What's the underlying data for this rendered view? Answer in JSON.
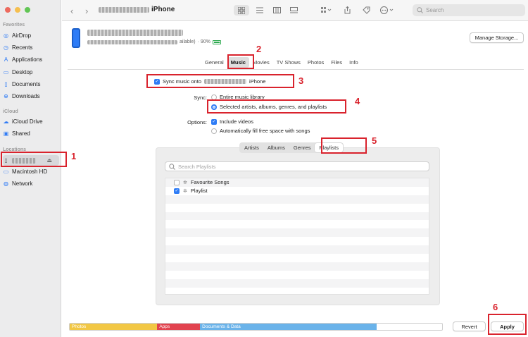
{
  "sidebar": {
    "favorites_header": "Favorites",
    "favorites": [
      {
        "label": "AirDrop",
        "icon": "airdrop-icon",
        "glyph": "◎"
      },
      {
        "label": "Recents",
        "icon": "clock-icon",
        "glyph": "◷"
      },
      {
        "label": "Applications",
        "icon": "applications-icon",
        "glyph": "A"
      },
      {
        "label": "Desktop",
        "icon": "desktop-icon",
        "glyph": "▭"
      },
      {
        "label": "Documents",
        "icon": "document-icon",
        "glyph": "▯"
      },
      {
        "label": "Downloads",
        "icon": "download-icon",
        "glyph": "⊕"
      }
    ],
    "icloud_header": "iCloud",
    "icloud": [
      {
        "label": "iCloud Drive",
        "icon": "cloud-icon",
        "glyph": "☁"
      },
      {
        "label": "Shared",
        "icon": "shared-folder-icon",
        "glyph": "▣"
      }
    ],
    "locations_header": "Locations",
    "locations": [
      {
        "label": "Macintosh HD",
        "icon": "disk-icon",
        "glyph": "▭"
      },
      {
        "label": "Network",
        "icon": "globe-icon",
        "glyph": "◍"
      }
    ],
    "eject_glyph": "⏏"
  },
  "toolbar": {
    "title_suffix": "iPhone",
    "back_glyph": "‹",
    "forward_glyph": "›",
    "search_placeholder": "Search"
  },
  "device": {
    "storage_fragment": "ailable)",
    "battery_text": "· 90%",
    "manage_storage_label": "Manage Storage..."
  },
  "tabs": [
    "General",
    "Music",
    "Movies",
    "TV Shows",
    "Photos",
    "Files",
    "Info"
  ],
  "active_tab": "Music",
  "sync": {
    "sync_music_prefix": "Sync music onto",
    "sync_music_suffix": "iPhone",
    "sync_label": "Sync:",
    "option_entire": "Entire music library",
    "option_selected": "Selected artists, albums, genres, and playlists",
    "options_label": "Options:",
    "include_videos": "Include videos",
    "autofill": "Automatically fill free space with songs"
  },
  "segments": [
    "Artists",
    "Albums",
    "Genres",
    "Playlists"
  ],
  "active_segment": "Playlists",
  "playlist_search_placeholder": "Search Playlists",
  "playlists": [
    {
      "name": "Favourite Songs",
      "checked": false
    },
    {
      "name": "Playlist",
      "checked": true
    }
  ],
  "storage_bar": [
    {
      "label": "Photos",
      "color": "#f2c744",
      "fraction": 0.235
    },
    {
      "label": "Apps",
      "color": "#e2434f",
      "fraction": 0.115
    },
    {
      "label": "Documents & Data",
      "color": "#6ab3ea",
      "fraction": 0.475
    }
  ],
  "buttons": {
    "revert": "Revert",
    "apply": "Apply"
  },
  "annotations": [
    "1",
    "2",
    "3",
    "4",
    "5",
    "6"
  ],
  "annotation_color": "#d9232d"
}
